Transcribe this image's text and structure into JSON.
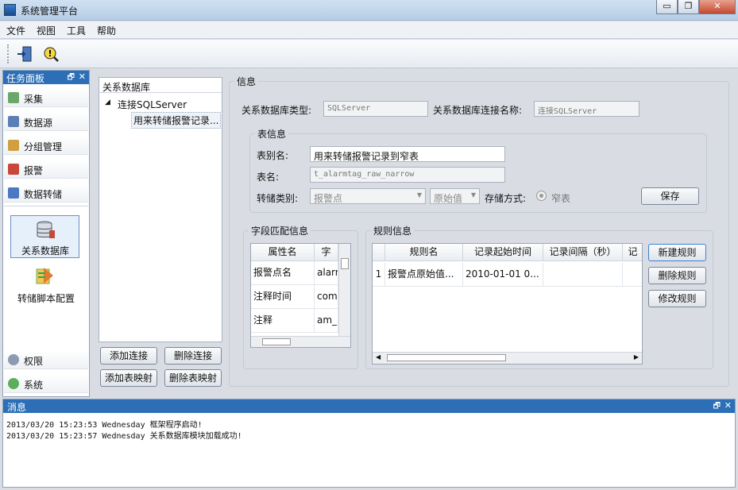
{
  "window": {
    "title": "系统管理平台",
    "minimize": "▭",
    "restore": "❐",
    "close": "✕"
  },
  "menu": [
    "文件",
    "视图",
    "工具",
    "帮助"
  ],
  "task_panel": {
    "title": "任务面板",
    "pin": "🗗",
    "close": "✕",
    "items": [
      "采集",
      "数据源",
      "分组管理",
      "报警",
      "数据转储"
    ],
    "modules": [
      "关系数据库",
      "转储脚本配置"
    ],
    "bottom_items": [
      "权限",
      "系统"
    ]
  },
  "db_panel": {
    "title": "关系数据库",
    "tree_root": "连接SQLServer",
    "tree_child": "用来转储报警记录..."
  },
  "buttons": {
    "add_conn": "添加连接",
    "del_conn": "删除连接",
    "add_map": "添加表映射",
    "del_map": "删除表映射",
    "save": "保存",
    "new_rule": "新建规则",
    "del_rule": "删除规则",
    "edit_rule": "修改规则"
  },
  "info": {
    "legend": "信息",
    "db_type_label": "关系数据库类型:",
    "db_type_value": "SQLServer",
    "conn_name_label": "关系数据库连接名称:",
    "conn_name_value": "连接SQLServer"
  },
  "table_info": {
    "legend": "表信息",
    "alias_label": "表别名:",
    "alias_value": "用来转储报警记录到窄表",
    "name_label": "表名:",
    "name_value": "t_alarmtag_raw_narrow",
    "dump_type_label": "转储类别:",
    "dump_type_value": "报警点",
    "raw_value": "原始值",
    "storage_label": "存储方式:",
    "storage_value": "窄表"
  },
  "field_match": {
    "legend": "字段匹配信息",
    "headers": [
      "属性名",
      "字"
    ],
    "rows": [
      [
        "报警点名",
        "alarm"
      ],
      [
        "注释时间",
        "com"
      ],
      [
        "注释",
        "am_"
      ]
    ]
  },
  "rules": {
    "legend": "规则信息",
    "headers": [
      "",
      "规则名",
      "记录起始时间",
      "记录间隔（秒）",
      "记"
    ],
    "rows": [
      [
        "1",
        "报警点原始值...",
        "2010-01-01 0...",
        "",
        ""
      ]
    ]
  },
  "messages": {
    "title": "消息",
    "lines": [
      "2013/03/20 15:23:53 Wednesday 框架程序启动!",
      "2013/03/20 15:23:57 Wednesday 关系数据库模块加载成功!"
    ]
  }
}
